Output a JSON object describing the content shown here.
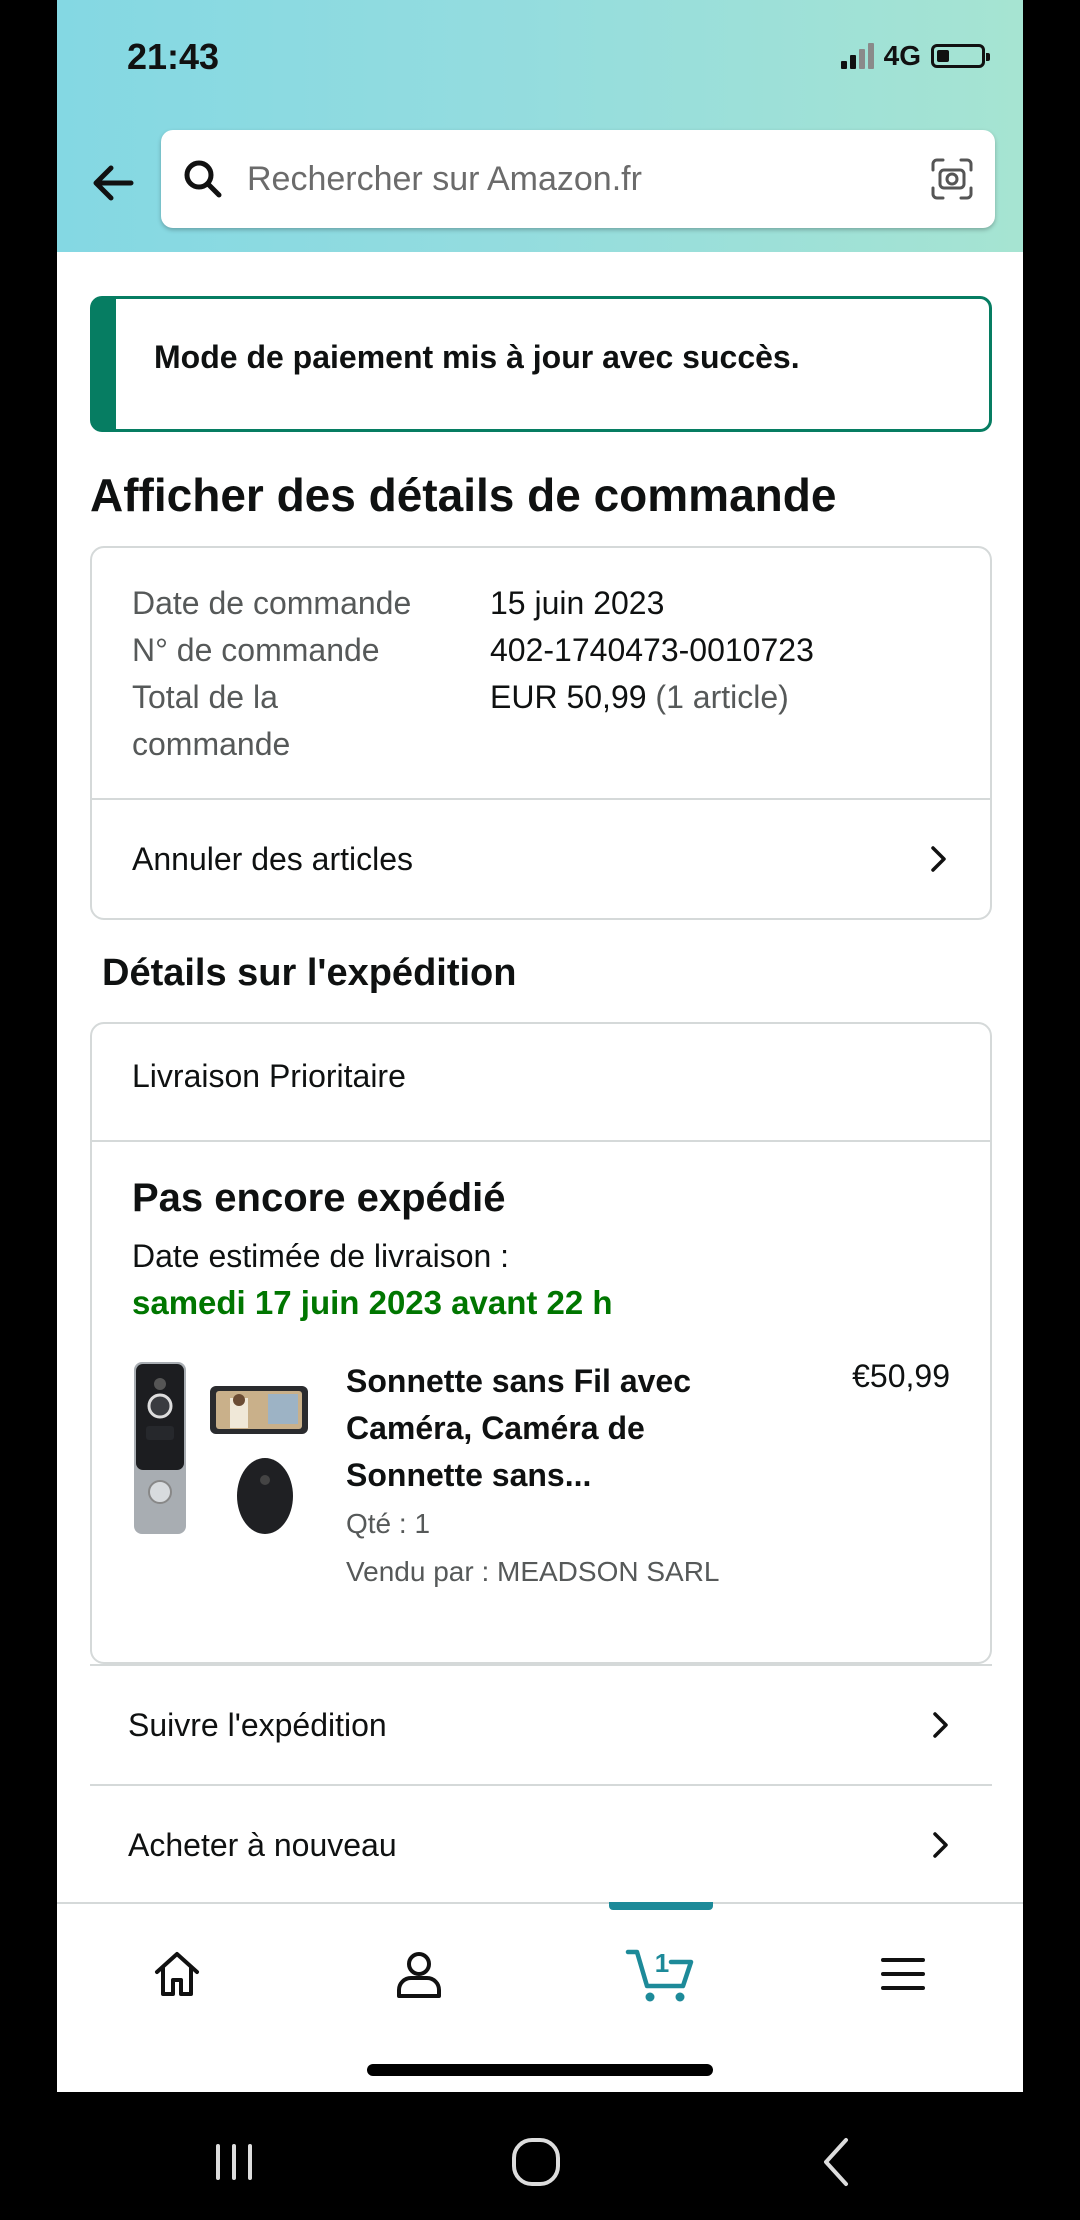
{
  "status_bar": {
    "time": "21:43",
    "network": "4G",
    "signal_bars": 4,
    "signal_active": 2,
    "battery_level": 0.3
  },
  "search": {
    "placeholder": "Rechercher sur Amazon.fr",
    "icons": [
      "back-arrow-icon",
      "search-icon",
      "camera-icon"
    ]
  },
  "banner": {
    "message": "Mode de paiement mis à jour avec succès.",
    "color": "#067d62"
  },
  "page_title": "Afficher des détails de commande",
  "order": {
    "date_label": "Date de commande",
    "date_value": "15 juin 2023",
    "number_label": "N° de commande",
    "number_value": "402-1740473-0010723",
    "total_label_line1": "Total de la",
    "total_label_line2": "commande",
    "total_value": "EUR 50,99",
    "total_count": "(1 article)",
    "cancel_label": "Annuler des articles"
  },
  "shipping": {
    "section_title": "Détails sur l'expédition",
    "delivery_type": "Livraison Prioritaire",
    "status": "Pas encore expédié",
    "estimate_label": "Date estimée de livraison :",
    "estimate_date": "samedi 17 juin 2023 avant 22 h",
    "estimate_color": "#007600",
    "product": {
      "title_line1": "Sonnette sans Fil avec",
      "title_line2": "Caméra, Caméra de",
      "title_line3": "Sonnette sans...",
      "price": "€50,99",
      "quantity": "Qté : 1",
      "seller": "Vendu par : MEADSON SARL"
    }
  },
  "actions": {
    "track": "Suivre l'expédition",
    "buy_again": "Acheter à nouveau"
  },
  "tabbar": {
    "tabs": [
      "home-icon",
      "account-icon",
      "cart-icon",
      "menu-icon"
    ],
    "active": "cart-icon",
    "cart_count": "1",
    "accent": "#1d8a99"
  },
  "android_nav": [
    "recents-icon",
    "home-circle-icon",
    "back-chevron-icon"
  ]
}
